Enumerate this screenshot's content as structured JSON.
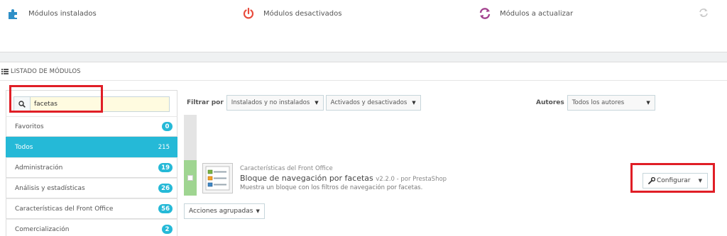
{
  "stats": {
    "installed_label": "Módulos instalados",
    "disabled_label": "Módulos desactivados",
    "to_update_label": "Módulos a actualizar"
  },
  "panel": {
    "title": "LISTADO DE MÓDULOS"
  },
  "search": {
    "value": "facetas"
  },
  "categories": [
    {
      "label": "Favoritos",
      "count": "0"
    },
    {
      "label": "Todos",
      "count": "215"
    },
    {
      "label": "Administración",
      "count": "19"
    },
    {
      "label": "Análisis y estadísticas",
      "count": "26"
    },
    {
      "label": "Características del Front Office",
      "count": "56"
    },
    {
      "label": "Comercialización",
      "count": "2"
    }
  ],
  "filters": {
    "label": "Filtrar por",
    "install_option": "Instalados y no instalados",
    "status_option": "Activados y desactivados",
    "authors_label": "Autores",
    "authors_option": "Todos los autores"
  },
  "module": {
    "category": "Características del Front Office",
    "name": "Bloque de navegación por facetas",
    "version": "v2.2.0 - por PrestaShop",
    "description": "Muestra un bloque con los filtros de navegación por facetas.",
    "configure_label": "Configurar"
  },
  "bulk_actions_label": "Acciones agrupadas",
  "colors": {
    "accent": "#25b9d7",
    "highlight": "#e01e26",
    "enabled_strip": "#9fd591"
  }
}
